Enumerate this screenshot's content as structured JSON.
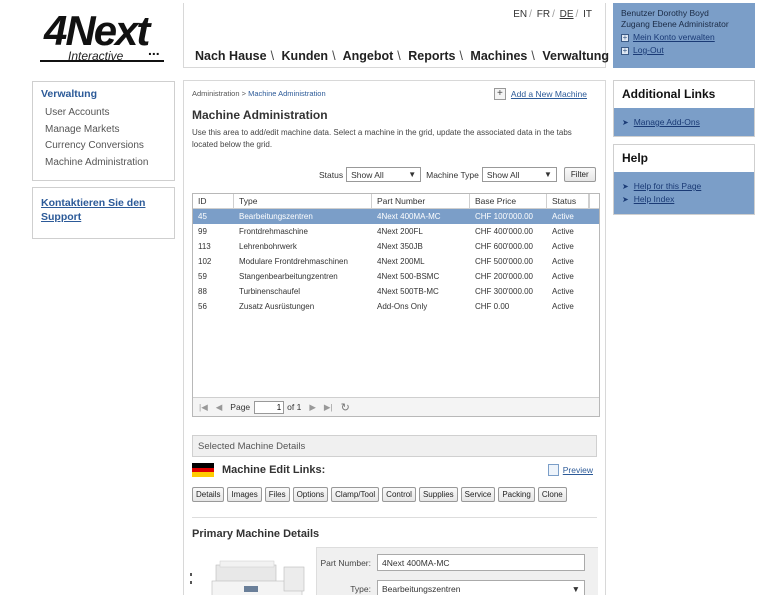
{
  "logo": {
    "main": "4Next",
    "dots": "...",
    "sub": "Interactive"
  },
  "header": {
    "languages": [
      {
        "code": "EN",
        "active": false
      },
      {
        "code": "FR",
        "active": false
      },
      {
        "code": "DE",
        "active": true
      },
      {
        "code": "IT",
        "active": false
      }
    ],
    "nav": [
      "Nach Hause",
      "Kunden",
      "Angebot",
      "Reports",
      "Machines",
      "Verwaltung"
    ]
  },
  "user": {
    "name_line": "Benutzer Dorothy Boyd",
    "level_line": "Zugang Ebene Administrator",
    "account_link": "Mein Konto verwalten",
    "logout_link": "Log-Out"
  },
  "sidebar": {
    "title": "Verwaltung",
    "items": [
      "User Accounts",
      "Manage Markets",
      "Currency Conversions",
      "Machine Administration"
    ],
    "support_link": "Kontaktieren Sie den Support"
  },
  "right": {
    "additional_title": "Additional Links",
    "additional_links": [
      "Manage Add-Ons"
    ],
    "help_title": "Help",
    "help_links": [
      "Help for this Page",
      "Help Index"
    ]
  },
  "content": {
    "breadcrumb_root": "Administration",
    "breadcrumb_sep": " > ",
    "breadcrumb_current": "Machine Administration",
    "add_link": "Add a New Machine",
    "title": "Machine Administration",
    "description": "Use this area to add/edit machine data. Select a machine in the grid, update the associated data in the tabs located below the grid.",
    "filters": {
      "status_label": "Status",
      "status_value": "Show All",
      "type_label": "Machine Type",
      "type_value": "Show All",
      "filter_button": "Filter"
    },
    "grid": {
      "columns": [
        "ID",
        "Type",
        "Part Number",
        "Base Price",
        "Status"
      ],
      "rows": [
        [
          "45",
          "Bearbeitungszentren",
          "4Next 400MA-MC",
          "CHF 100'000.00",
          "Active"
        ],
        [
          "99",
          "Frontdrehmaschine",
          "4Next 200FL",
          "CHF 400'000.00",
          "Active"
        ],
        [
          "113",
          "Lehrenbohrwerk",
          "4Next 350JB",
          "CHF 600'000.00",
          "Active"
        ],
        [
          "102",
          "Modulare Frontdrehmaschinen",
          "4Next 200ML",
          "CHF 500'000.00",
          "Active"
        ],
        [
          "59",
          "Stangenbearbeitungzentren",
          "4Next 500-BSMC",
          "CHF 200'000.00",
          "Active"
        ],
        [
          "88",
          "Turbinenschaufel",
          "4Next 500TB-MC",
          "CHF 300'000.00",
          "Active"
        ],
        [
          "56",
          "Zusatz Ausrüstungen",
          "Add-Ons Only",
          "CHF 0.00",
          "Active"
        ]
      ],
      "selected_index": 0,
      "pager": {
        "page_label": "Page",
        "page_value": "1",
        "of_label": "of 1"
      }
    },
    "selected_details_title": "Selected Machine Details",
    "edit_links_title": "Machine Edit Links:",
    "preview_link": "Preview",
    "edit_buttons": [
      "Details",
      "Images",
      "Files",
      "Options",
      "Clamp/Tool",
      "Control",
      "Supplies",
      "Service",
      "Packing",
      "Clone"
    ],
    "primary_title": "Primary Machine Details",
    "form": {
      "part_number_label": "Part Number:",
      "part_number_value": "4Next 400MA-MC",
      "type_label": "Type:",
      "type_value": "Bearbeitungszentren"
    }
  },
  "colors": {
    "accent_blue": "#7b9ec8",
    "link_blue": "#2c5a98"
  }
}
